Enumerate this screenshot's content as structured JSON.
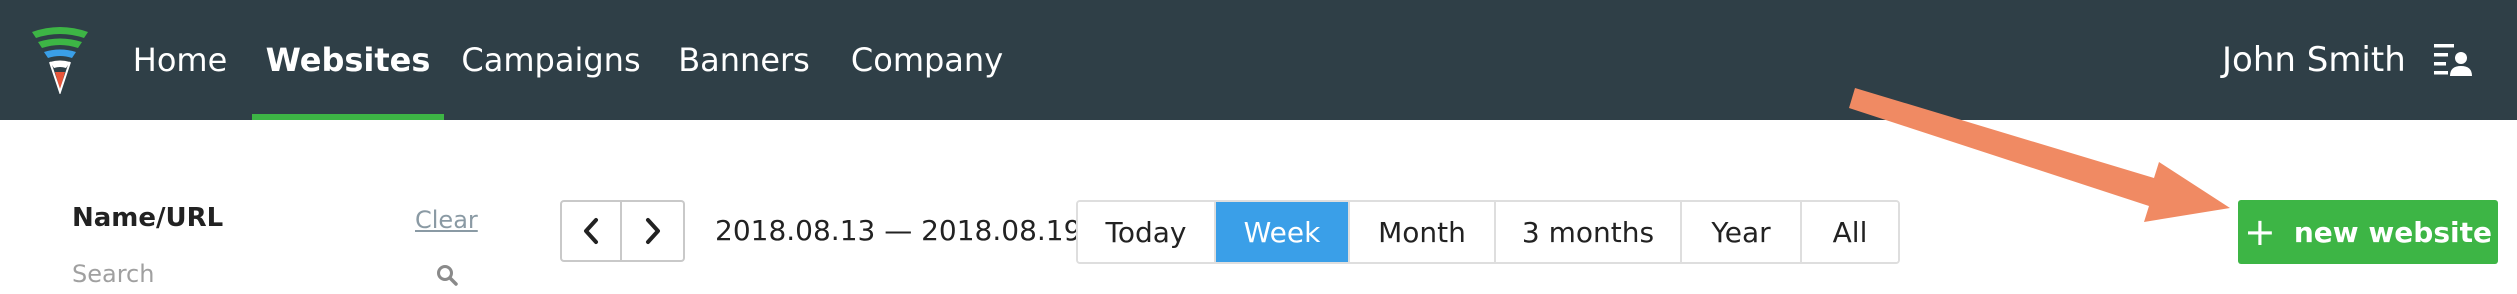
{
  "nav": {
    "items": [
      {
        "label": "Home"
      },
      {
        "label": "Websites",
        "active": true
      },
      {
        "label": "Campaigns"
      },
      {
        "label": "Banners"
      },
      {
        "label": "Company"
      }
    ],
    "active_color": "#3db545"
  },
  "user": {
    "name": "John Smith",
    "icon": "user-list-icon"
  },
  "filter": {
    "title": "Name/URL",
    "clear_label": "Clear",
    "search_placeholder": "Search"
  },
  "date": {
    "prev_icon": "chevron-left-icon",
    "next_icon": "chevron-right-icon",
    "range": "2018.08.13 — 2018.08.19"
  },
  "periods": [
    {
      "label": "Today"
    },
    {
      "label": "Week",
      "active": true
    },
    {
      "label": "Month"
    },
    {
      "label": "3 months"
    },
    {
      "label": "Year"
    },
    {
      "label": "All"
    }
  ],
  "actions": {
    "new_website_label": "new website",
    "plus_icon": "plus-icon"
  },
  "colors": {
    "topbar": "#2f3f47",
    "accent_green": "#3db545",
    "accent_blue": "#3a9fe8",
    "annotation_arrow": "#f08a63"
  }
}
